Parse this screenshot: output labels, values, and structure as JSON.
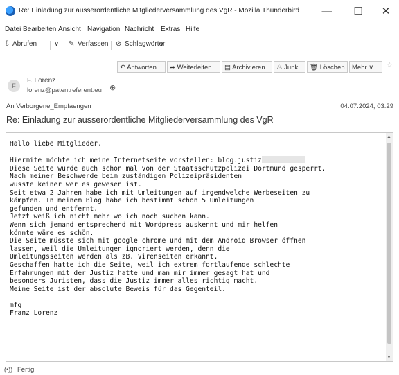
{
  "window": {
    "title": "Re: Einladung zur ausserordentliche Mitgliederversammlung des VgR - Mozilla Thunderbird",
    "minimize": "—",
    "maximize": "☐",
    "close": "✕"
  },
  "menu": {
    "items": [
      "Datei",
      "Bearbeiten",
      "Ansicht",
      "Navigation",
      "Nachricht",
      "Extras",
      "Hilfe"
    ]
  },
  "toolbar": {
    "abrufen": "Abrufen",
    "verfassen": "Verfassen",
    "schlagwoerter": "Schlagwörter"
  },
  "actions": {
    "antworten": "Antworten",
    "weiterleiten": "Weiterleiten",
    "archivieren": "Archivieren",
    "junk": "Junk",
    "loeschen": "Löschen",
    "mehr": "Mehr"
  },
  "message": {
    "avatar_initial": "F",
    "from_name": "F. Lorenz",
    "from_email": "lorenz@patentreferent.eu",
    "to": "An Verborgene_Empfaengen ;",
    "date": "04.07.2024, 03:29",
    "subject": "Re: Einladung zur ausserordentliche Mitgliederversammlung des VgR",
    "body_line_1": "Hallo liebe Mitglieder.",
    "body_line_2_prefix": "Hiermite möchte ich meine Internetseite vorstellen: blog.justiz",
    "body_lines_rest": "Diese Seite wurde auch schon mal von der Staatsschutzpolizei Dortmund gesperrt.\nNach meiner Beschwerde beim zuständigen Polizeipräsidenten\nwusste keiner wer es gewesen ist.\nSeit etwa 2 Jahren habe ich mit Umleitungen auf irgendwelche Werbeseiten zu\nkämpfen. In meinem Blog habe ich bestimmt schon 5 Umleitungen\ngefunden und entfernt.\nJetzt weiß ich nicht mehr wo ich noch suchen kann.\nWenn sich jemand entsprechend mit Wordpress auskennt und mir helfen\nkönnte wäre es schön.\nDie Seite müsste sich mit google chrome und mit dem Android Browser öffnen\nlassen, weil die Umleitungen ignoriert werden, denn die\nUmleitungsseiten werden als zB. Virenseiten erkannt.\nGeschaffen hatte ich die Seite, weil ich extrem fortlaufende schlechte\nErfahrungen mit der Justiz hatte und man mir immer gesagt hat und\nbesonders Juristen, dass die Justiz immer alles richtig macht.\nMeine Seite ist der absolute Beweis für das Gegenteil.",
    "signoff_1": "mfg",
    "signoff_2": "Franz Lorenz"
  },
  "status": {
    "icon": "(•))",
    "text": "Fertig"
  }
}
